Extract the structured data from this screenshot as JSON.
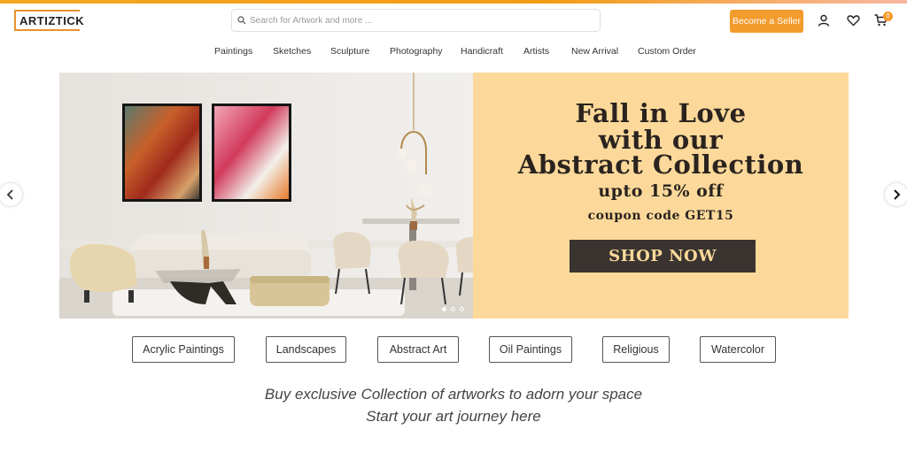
{
  "header": {
    "logo_text": "ARTIZTICK",
    "search_placeholder": "Search for Artwork and more ...",
    "search_value": "",
    "seller_button": "Become a Seller",
    "cart_count": "0",
    "icons": [
      "search-icon",
      "user-icon",
      "heart-icon",
      "cart-icon"
    ]
  },
  "nav": {
    "items": [
      "Paintings",
      "Sketches",
      "Sculpture",
      "Photography",
      "Handicraft",
      "Artists",
      "New Arrival",
      "Custom Order"
    ]
  },
  "hero": {
    "line1": "Fall in Love",
    "line2": "with our",
    "line3": "Abstract Collection",
    "line4": "upto 15% off",
    "line5": "coupon code GET15",
    "cta": "SHOP NOW",
    "slides": 3,
    "active_slide": 1
  },
  "categories": [
    "Acrylic Paintings",
    "Landscapes",
    "Abstract Art",
    "Oil Paintings",
    "Religious",
    "Watercolor"
  ],
  "tagline": {
    "line1": "Buy exclusive Collection of artworks to adorn your space",
    "line2": "Start your art journey here"
  },
  "colors": {
    "accent": "#f39b2c",
    "promo_bg": "#fcd99a",
    "cta_bg": "#3a3430"
  }
}
